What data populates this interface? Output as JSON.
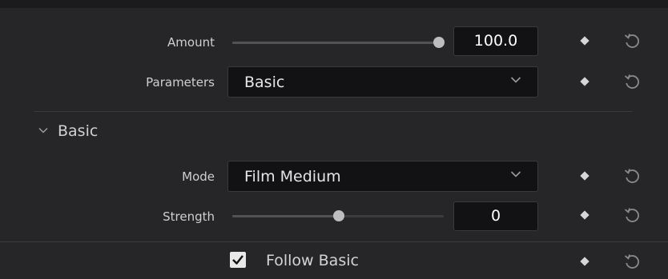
{
  "amount": {
    "label": "Amount",
    "value": "100.0",
    "level": 1.0
  },
  "parameters": {
    "label": "Parameters",
    "selected": "Basic"
  },
  "basic_section": {
    "title": "Basic"
  },
  "mode": {
    "label": "Mode",
    "selected": "Film Medium"
  },
  "strength": {
    "label": "Strength",
    "value": "0",
    "level": 0.5
  },
  "follow_basic": {
    "label": "Follow Basic",
    "checked": true
  },
  "icons": {
    "keyframe": "keyframe-diamond-icon",
    "reset": "reset-icon",
    "chevron": "chevron-down-icon",
    "check": "checkmark-icon"
  },
  "colors": {
    "panel": "#262628",
    "field": "#121214",
    "text": "#d4d4d4"
  }
}
